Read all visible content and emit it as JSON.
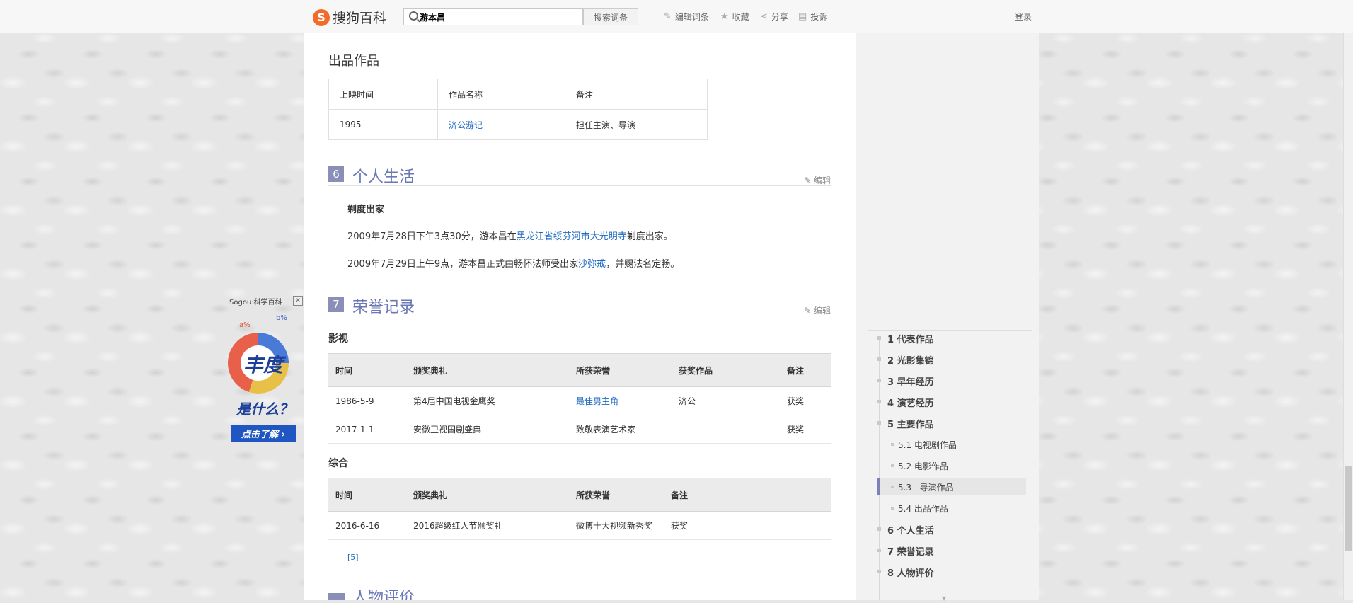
{
  "header": {
    "logo_mark": "S",
    "logo_text": "搜狗百科",
    "search_value": "游本昌",
    "search_button": "搜索词条",
    "edit_entry": "编辑词条",
    "favorite": "收藏",
    "share": "分享",
    "report": "投诉",
    "login": "登录"
  },
  "works": {
    "heading": "出品作品",
    "columns": [
      "上映时间",
      "作品名称",
      "备注"
    ],
    "rows": [
      {
        "year": "1995",
        "title": "济公游记",
        "note": "担任主演、导演"
      }
    ]
  },
  "sections": {
    "personal": {
      "num": "6",
      "title": "个人生活",
      "edit": "编辑",
      "subheading": "剃度出家",
      "p1_pre": "2009年7月28日下午3点30分，游本昌在",
      "p1_link": "黑龙江省绥芬河市大光明寺",
      "p1_post": "剃度出家。",
      "p2_pre": "2009年7月29日上午9点，游本昌正式由畅怀法师受出家",
      "p2_link": "沙弥戒",
      "p2_post": "，并赐法名定畅。"
    },
    "honors": {
      "num": "7",
      "title": "荣誉记录",
      "edit": "编辑",
      "film_tv": {
        "label": "影视",
        "columns": [
          "时间",
          "颁奖典礼",
          "所获荣誉",
          "获奖作品",
          "备注"
        ],
        "rows": [
          [
            "1986-5-9",
            "第4届中国电视金鹰奖",
            "最佳男主角",
            "济公",
            "获奖"
          ],
          [
            "2017-1-1",
            "安徽卫视国剧盛典",
            "致敬表演艺术家",
            "----",
            "获奖"
          ]
        ]
      },
      "general": {
        "label": "综合",
        "columns": [
          "时间",
          "颁奖典礼",
          "所获荣誉",
          "备注"
        ],
        "rows": [
          [
            "2016-6-16",
            "2016超级红人节颁奖礼",
            "微博十大视频新秀奖",
            "获奖"
          ]
        ]
      },
      "citation": "[5]"
    },
    "next_title": "人物评价"
  },
  "ad": {
    "brand": "Sogou·科学百科",
    "close": "✕",
    "label_a": "a%",
    "label_b": "b%",
    "big_char": "丰度",
    "question": "是什么？",
    "button": "点击了解 ›"
  },
  "toc": {
    "items": [
      {
        "num": "1",
        "label": "代表作品"
      },
      {
        "num": "2",
        "label": "光影集锦"
      },
      {
        "num": "3",
        "label": "早年经历"
      },
      {
        "num": "4",
        "label": "演艺经历"
      },
      {
        "num": "5",
        "label": "主要作品"
      },
      {
        "num": "5.1",
        "label": "电视剧作品"
      },
      {
        "num": "5.2",
        "label": "电影作品"
      },
      {
        "num": "5.3",
        "label": "导演作品"
      },
      {
        "num": "5.4",
        "label": "出品作品"
      },
      {
        "num": "6",
        "label": "个人生活"
      },
      {
        "num": "7",
        "label": "荣誉记录"
      },
      {
        "num": "8",
        "label": "人物评价"
      }
    ],
    "active_index": 7
  },
  "colors": {
    "accent": "#6a78b6",
    "link": "#1f6bbf",
    "logo": "#f26b2a"
  }
}
